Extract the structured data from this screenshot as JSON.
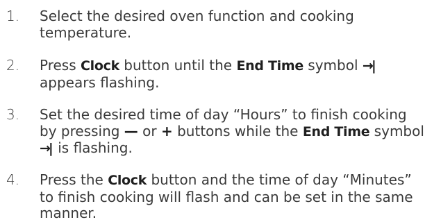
{
  "steps": [
    {
      "number": "1.",
      "line1": "Select the desired oven function and cooking",
      "line2": "temperature."
    },
    {
      "number": "2.",
      "press": "Press ",
      "clock": "Clock",
      "until": " button until the ",
      "end_time": "End Time",
      "symbol_word": " symbol ",
      "line2": "appears flashing."
    },
    {
      "number": "3.",
      "line1": "Set the desired time of day “Hours” to finish cooking",
      "by": "by pressing ",
      "minus_symbol": "—",
      "or": " or ",
      "plus_symbol": "+",
      "buttons_while": " buttons while the ",
      "end_time": "End Time",
      "symbol_word": " symbol",
      "line3": "is flashing."
    },
    {
      "number": "4.",
      "press": "Press the ",
      "clock": "Clock",
      "rest1": " button and the time of day “Minutes”",
      "line2": "to finish cooking will flash and can be set in the same",
      "line3": "manner."
    }
  ],
  "icons": {
    "end_time_icon": "arrow-to-bar-icon",
    "minus_icon": "minus-icon",
    "plus_icon": "plus-icon"
  }
}
